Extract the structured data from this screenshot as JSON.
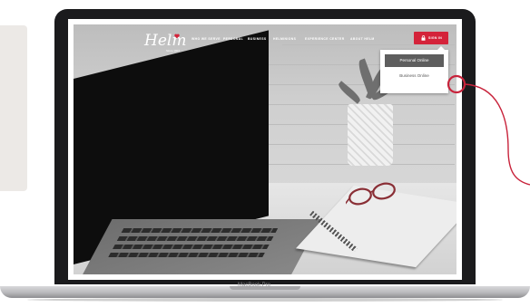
{
  "site": {
    "logo_text": "Helm",
    "logo_subtitle": "Since 1907",
    "nav_items": [
      "WHO WE SERVE",
      "PERSONAL",
      "BUSINESS",
      "HELMINIONS",
      "EXPERIENCE CENTER",
      "ABOUT HELM"
    ],
    "signin_label": "SIGN IN",
    "dropdown": {
      "items": [
        "Personal Online",
        "Business Online"
      ]
    }
  },
  "device": {
    "label": "MacBook Pro"
  },
  "colors": {
    "brand_red": "#d4233a",
    "highlight": "#5e5e5e",
    "annotation": "#c8233b"
  },
  "icons": [
    "lock-icon",
    "heart-icon"
  ]
}
